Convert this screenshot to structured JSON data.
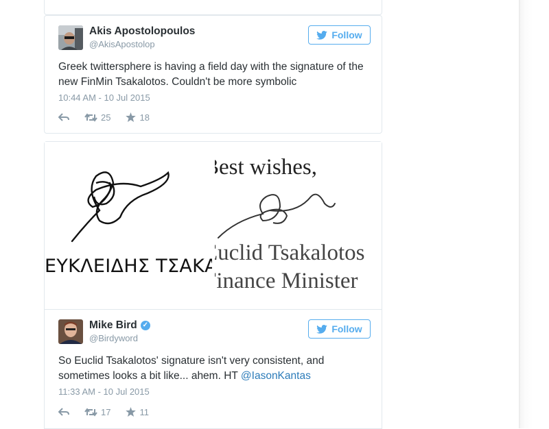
{
  "tweets": [
    {
      "name": "Akis Apostolopoulos",
      "handle": "@AkisApostolop",
      "verified": false,
      "follow_label": "Follow",
      "text": "Greek twittersphere is having a field day with the signature of the new FinMin Tsakalotos. Couldn't be more symbolic",
      "timestamp": "10:44 AM - 10 Jul 2015",
      "retweets": "25",
      "favorites": "18"
    },
    {
      "name": "Mike Bird",
      "handle": "@Birdyword",
      "verified": true,
      "follow_label": "Follow",
      "text_before_mention": "So Euclid Tsakalotos' signature isn't very consistent, and sometimes looks a bit like... ahem. HT ",
      "mention": "@IasonKantas",
      "timestamp": "11:33 AM - 10 Jul 2015",
      "retweets": "17",
      "favorites": "11"
    }
  ],
  "photo": {
    "left_caption": "ΕΥΚΛΕΙΔΗΣ ΤΣΑΚΑΛΩΤΟΣ",
    "right_line1": "Best wishes,",
    "right_line2": "Euclid Tsakalotos",
    "right_line3": "Finance Minister"
  },
  "colors": {
    "accent": "#55acee",
    "link": "#2b7bb9",
    "muted": "#8899a6",
    "border": "#e1e8ed",
    "text": "#292f33"
  }
}
